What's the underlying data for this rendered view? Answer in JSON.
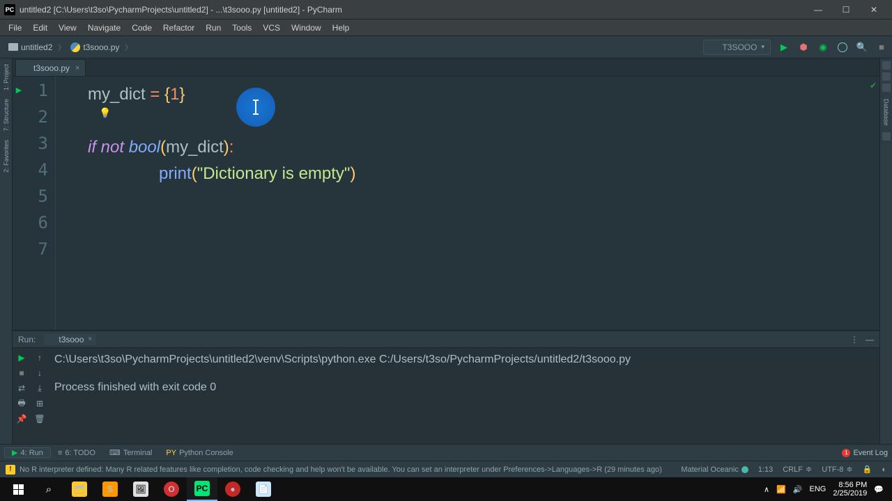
{
  "window": {
    "title": "untitled2 [C:\\Users\\t3so\\PycharmProjects\\untitled2] - ...\\t3sooo.py [untitled2] - PyCharm"
  },
  "menu": {
    "items": [
      "File",
      "Edit",
      "View",
      "Navigate",
      "Code",
      "Refactor",
      "Run",
      "Tools",
      "VCS",
      "Window",
      "Help"
    ]
  },
  "breadcrumb": {
    "project": "untitled2",
    "file": "t3sooo.py"
  },
  "runconfig": {
    "name": "T3SOOO"
  },
  "editor": {
    "tab": "t3sooo.py",
    "lines": [
      "1",
      "2",
      "3",
      "4",
      "5",
      "6",
      "7"
    ],
    "code": {
      "l1_a": "my_dict ",
      "l1_b": "= ",
      "l1_c": "{",
      "l1_d": "1",
      "l1_e": "}",
      "l3_a": "if ",
      "l3_b": "not ",
      "l3_c": "bool",
      "l3_d": "(",
      "l3_e": "my_dict",
      "l3_f": ")",
      "l3_g": ":",
      "l4_a": "print",
      "l4_b": "(",
      "l4_c": "\"Dictionary is empty\"",
      "l4_d": ")"
    }
  },
  "run": {
    "label": "Run:",
    "tab": "t3sooo",
    "line1": "C:\\Users\\t3so\\PycharmProjects\\untitled2\\venv\\Scripts\\python.exe C:/Users/t3so/PycharmProjects/untitled2/t3sooo.py",
    "line2": "",
    "line3": "Process finished with exit code 0"
  },
  "bottom": {
    "run": "4: Run",
    "todo": "6: TODO",
    "terminal": "Terminal",
    "pyconsole": "Python Console",
    "eventlog": "Event Log"
  },
  "status": {
    "msg": "No R interpreter defined: Many R related features like completion, code checking and help won't be available. You can set an interpreter under Preferences->Languages->R (29 minutes ago)",
    "theme": "Material Oceanic",
    "pos": "1:13",
    "crlf": "CRLF",
    "enc": "UTF-8",
    "lock": "🔒"
  },
  "taskbar": {
    "tray_up": "∧",
    "net": "📶",
    "vol": "🔊",
    "lang": "ENG",
    "time": "8:56 PM",
    "date": "2/25/2019",
    "notif": "💬"
  }
}
